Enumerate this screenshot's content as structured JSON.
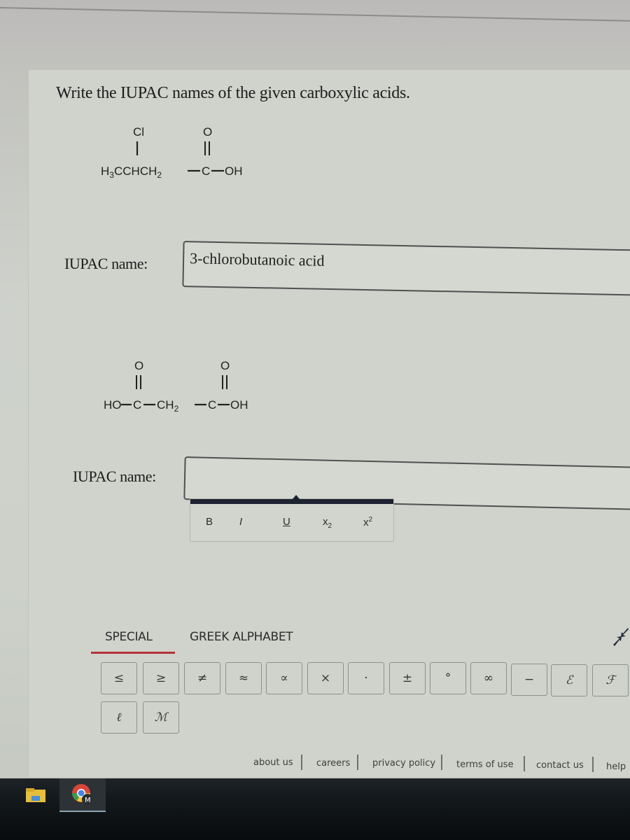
{
  "question": {
    "prompt": "Write the IUPAC names of the given carboxylic acids."
  },
  "items": [
    {
      "structure": {
        "substituent_atom": "Cl",
        "carbonyl_oxygen": "O",
        "chain": "H3CCHCH2",
        "carbon": "C",
        "hydroxyl": "OH"
      },
      "label": "IUPAC name:",
      "answer_value": "3-chlorobutanoic acid"
    },
    {
      "structure": {
        "left_hydroxyl": "HO",
        "left_carbon": "C",
        "left_oxygen": "O",
        "middle": "CH2",
        "right_carbon": "C",
        "right_oxygen": "O",
        "right_hydroxyl": "OH"
      },
      "label": "IUPAC name:",
      "answer_value": ""
    }
  ],
  "format_toolbar": {
    "bold": "B",
    "italic": "I",
    "underline": "U",
    "subscript_base": "x",
    "subscript": "2",
    "superscript_base": "x",
    "superscript": "2"
  },
  "symbol_panel": {
    "tabs": [
      {
        "label": "SPECIAL",
        "active": true
      },
      {
        "label": "GREEK ALPHABET",
        "active": false
      }
    ],
    "accent_color": "#b5323a",
    "row1": [
      "≤",
      "≥",
      "≠",
      "≈",
      "∝",
      "×",
      "·",
      "±",
      "°",
      "∞",
      "−",
      "ℰ",
      "ℱ"
    ],
    "row2": [
      "ℓ",
      "ℳ"
    ],
    "collapse_icon": "collapse-arrows-icon"
  },
  "footer": {
    "links": [
      "about us",
      "careers",
      "privacy policy",
      "terms of use",
      "contact us",
      "help"
    ]
  },
  "taskbar": {
    "apps": [
      {
        "name": "file-explorer-icon",
        "active": false
      },
      {
        "name": "chrome-profile-icon",
        "badge": "M",
        "active": true
      }
    ]
  }
}
